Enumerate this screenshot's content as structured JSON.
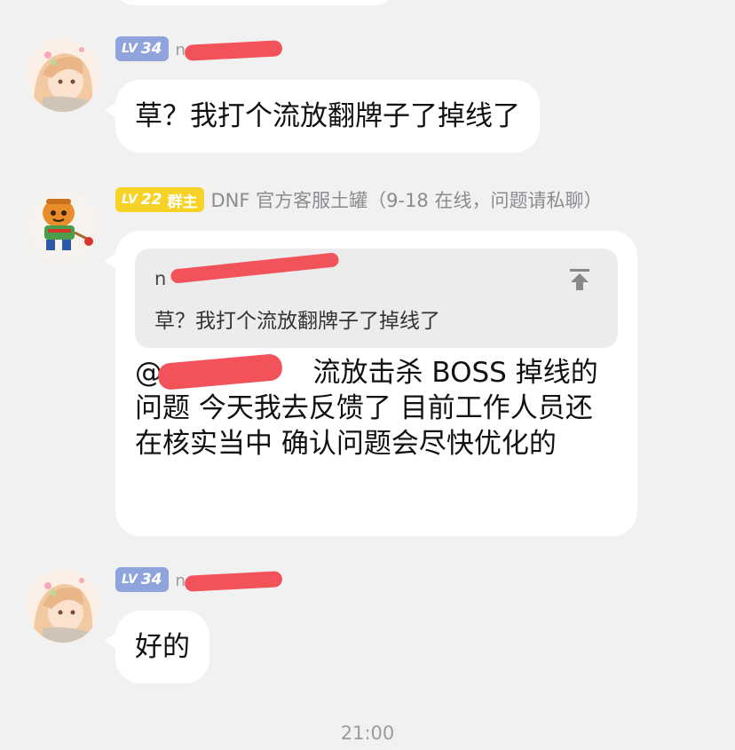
{
  "messages": [
    {
      "level_badge": "34",
      "level_prefix": "LV",
      "sender": "",
      "sender_hint": "n",
      "text": "草？我打个流放翻牌子了掉线了"
    },
    {
      "level_badge": "22",
      "level_prefix": "LV",
      "role_badge": "群主",
      "sender": "DNF 官方客服土罐（9-18 在线，问题请私聊）",
      "quote": {
        "sender": "n",
        "text": "草？我打个流放翻牌子了掉线了",
        "pin_icon": "pin-to-top-icon"
      },
      "mention": "@n",
      "text": " 流放击杀 BOSS 掉线的问题  今天我去反馈了 目前工作人员还在核实当中  确认问题会尽快优化的"
    },
    {
      "level_badge": "34",
      "level_prefix": "LV",
      "sender": "",
      "sender_hint": "n",
      "text": "好的"
    }
  ],
  "timestamp": "21:00",
  "colors": {
    "background": "#f1f1f2",
    "bubble": "#ffffff",
    "badge_blue": "#8fa3dc",
    "badge_yellow": "#f6d227",
    "redaction": "#f2525a"
  }
}
